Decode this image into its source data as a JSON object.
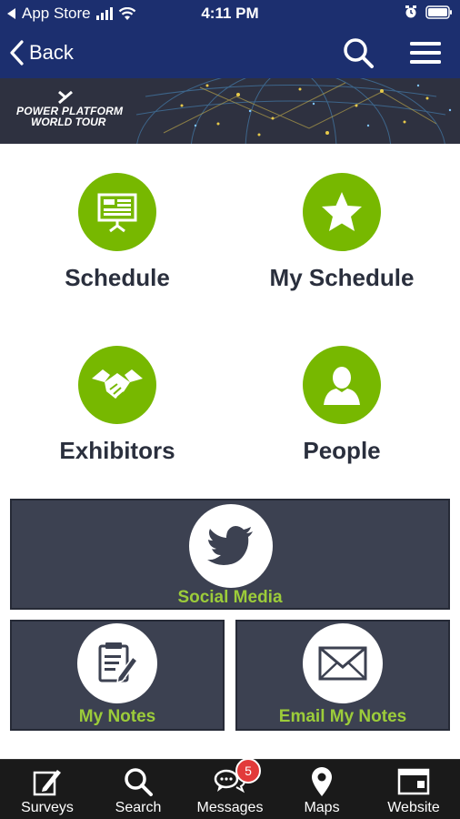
{
  "status_bar": {
    "back_app": "App Store",
    "time": "4:11 PM"
  },
  "nav": {
    "back_label": "Back"
  },
  "banner": {
    "line1": "POWER PLATFORM",
    "line2": "WORLD TOUR"
  },
  "tiles": [
    {
      "label": "Schedule",
      "icon": "presentation-board-icon"
    },
    {
      "label": "My Schedule",
      "icon": "star-icon"
    },
    {
      "label": "Exhibitors",
      "icon": "handshake-icon"
    },
    {
      "label": "People",
      "icon": "person-icon"
    }
  ],
  "cards": {
    "social": {
      "label": "Social Media",
      "icon": "twitter-bird-icon"
    },
    "notes": {
      "label": "My Notes",
      "icon": "notepad-pencil-icon"
    },
    "email": {
      "label": "Email My Notes",
      "icon": "envelope-icon"
    }
  },
  "tab_bar": {
    "items": [
      {
        "label": "Surveys",
        "icon": "survey-pencil-icon"
      },
      {
        "label": "Search",
        "icon": "search-icon"
      },
      {
        "label": "Messages",
        "icon": "chat-bubbles-icon"
      },
      {
        "label": "Maps",
        "icon": "map-pin-icon"
      },
      {
        "label": "Website",
        "icon": "browser-window-icon"
      }
    ],
    "messages_badge": "5"
  },
  "colors": {
    "nav_blue": "#1c2f6f",
    "accent_green": "#77b800",
    "card_dark": "#3c4151",
    "card_label_green": "#9ccc3a",
    "badge_red": "#e23a3a"
  }
}
